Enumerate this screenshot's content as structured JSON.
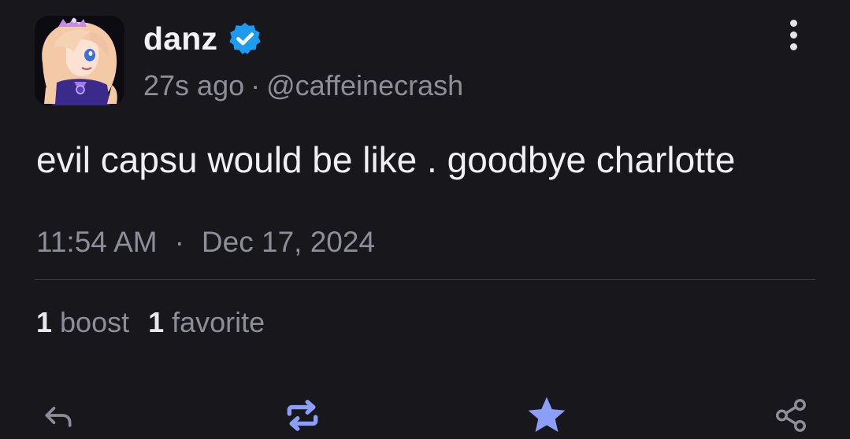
{
  "post": {
    "author": {
      "display_name": "danz",
      "handle": "@caffeinecrash",
      "verified": true
    },
    "relative_time": "27s ago",
    "meta_separator": "·",
    "text": "evil capsu would be like . goodbye charlotte",
    "time": "11:54 AM",
    "date_separator": "·",
    "date": "Dec 17, 2024",
    "stats": {
      "boosts_count": "1",
      "boosts_label": "boost",
      "favorites_count": "1",
      "favorites_label": "favorite"
    }
  },
  "actions": {
    "reply_icon": "reply-icon",
    "boost_icon": "boost-icon",
    "favorite_icon": "star-icon",
    "share_icon": "share-icon"
  },
  "colors": {
    "background": "#17171c",
    "accent": "#8c9ff8",
    "verified": "#1d9bf0",
    "muted_text": "#8e8e99"
  }
}
